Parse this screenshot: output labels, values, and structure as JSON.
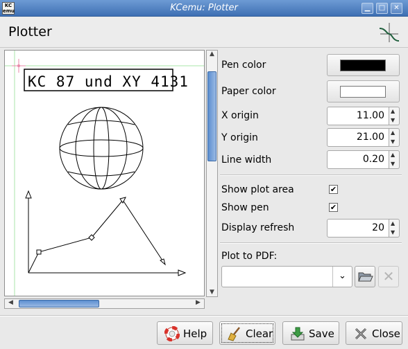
{
  "window": {
    "title": "KCemu: Plotter",
    "app_icon_text": "KC emu",
    "controls": [
      "minimize-icon",
      "maximize-icon",
      "close-icon"
    ]
  },
  "header": {
    "title": "Plotter",
    "icon": "plotter-curve-icon"
  },
  "canvas": {
    "plot_label": "KC 87 und XY 4131"
  },
  "settings": {
    "pen_color_label": "Pen color",
    "pen_color": "#000000",
    "paper_color_label": "Paper color",
    "paper_color": "#ffffff",
    "x_origin_label": "X origin",
    "x_origin_value": "11.00",
    "y_origin_label": "Y origin",
    "y_origin_value": "21.00",
    "line_width_label": "Line width",
    "line_width_value": "0.20",
    "show_plot_area_label": "Show plot area",
    "show_plot_area_checked": true,
    "show_pen_label": "Show pen",
    "show_pen_checked": true,
    "display_refresh_label": "Display refresh",
    "display_refresh_value": "20",
    "plot_to_pdf_label": "Plot to PDF:",
    "plot_to_pdf_value": ""
  },
  "buttons": {
    "help": "Help",
    "clear": "Clear",
    "save": "Save",
    "close": "Close"
  },
  "colors": {
    "titlebar": "#4a7cc0",
    "scroll_thumb": "#6f9ad6"
  }
}
